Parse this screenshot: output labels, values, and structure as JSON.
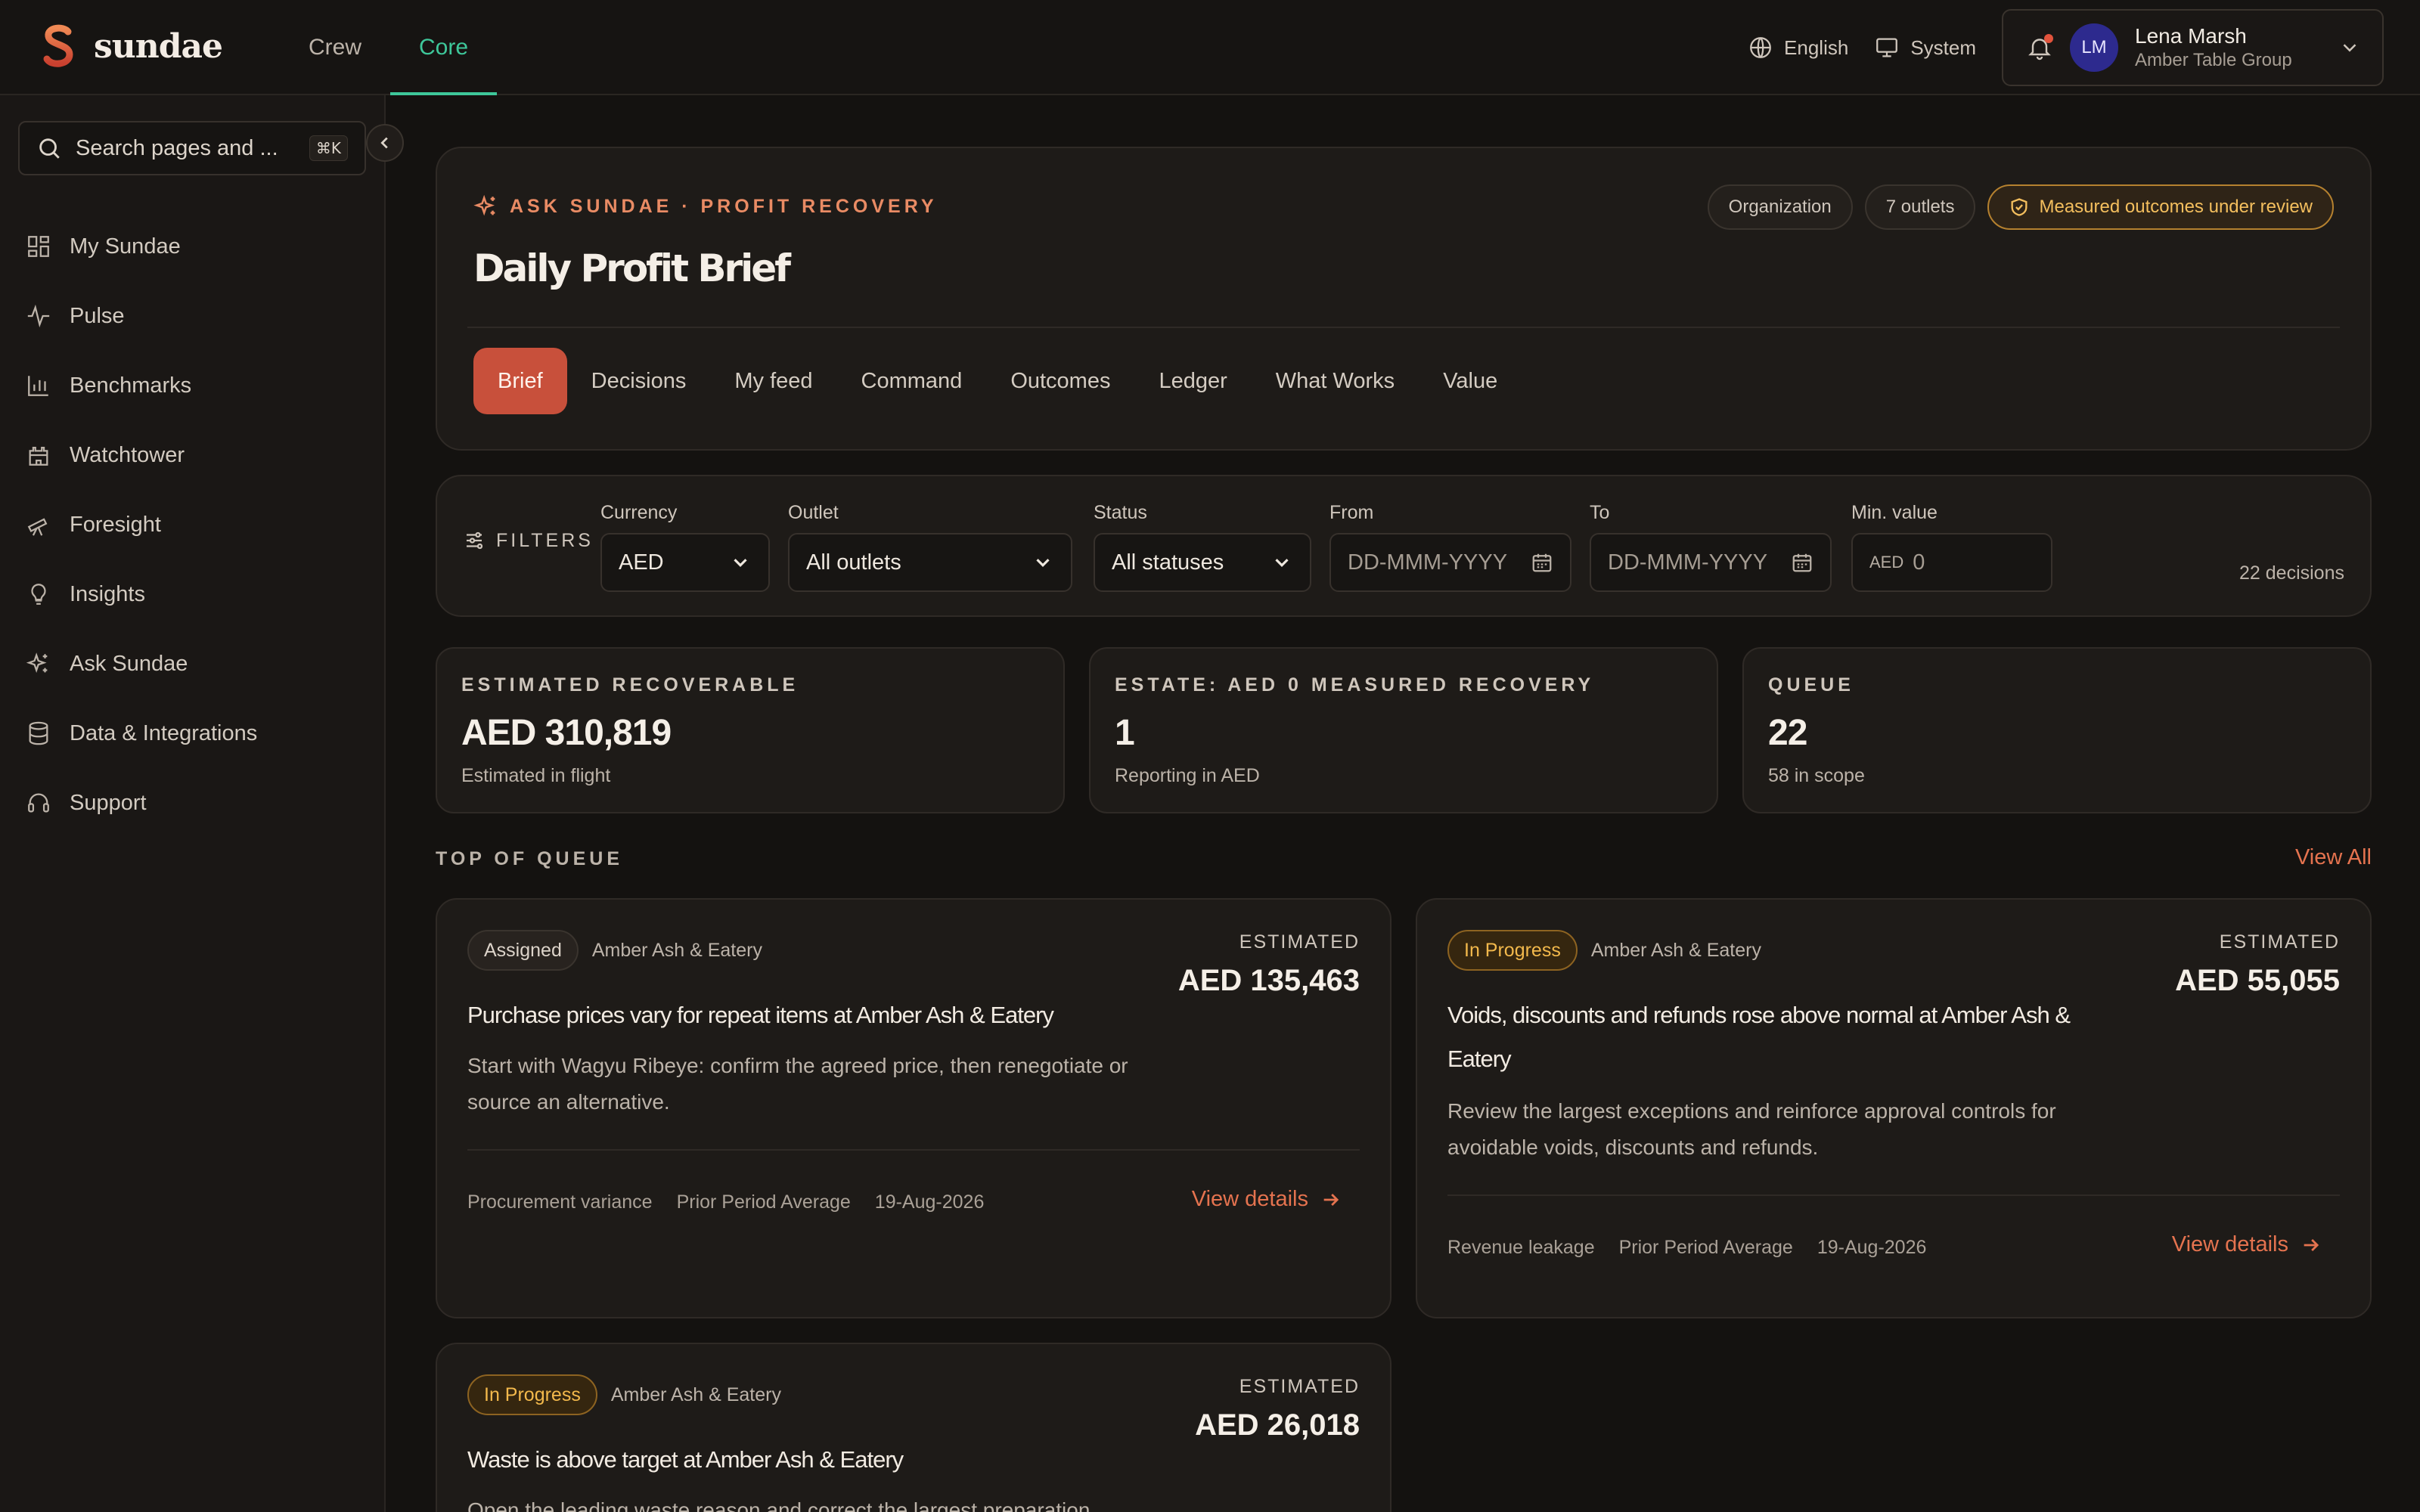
{
  "brand": {
    "name": "sundae",
    "accent": "#e5734f"
  },
  "topnav": [
    {
      "label": "Crew",
      "active": false
    },
    {
      "label": "Core",
      "active": true
    }
  ],
  "topbar": {
    "language": "English",
    "theme": "System",
    "user": {
      "initials": "LM",
      "name": "Lena Marsh",
      "org": "Amber Table Group"
    }
  },
  "sidebar": {
    "search_placeholder": "Search pages and ...",
    "shortcut": "⌘K",
    "items": [
      {
        "label": "My Sundae",
        "icon": "dashboard-icon"
      },
      {
        "label": "Pulse",
        "icon": "pulse-icon"
      },
      {
        "label": "Benchmarks",
        "icon": "bar-chart-icon"
      },
      {
        "label": "Watchtower",
        "icon": "castle-icon"
      },
      {
        "label": "Foresight",
        "icon": "telescope-icon"
      },
      {
        "label": "Insights",
        "icon": "lightbulb-icon"
      },
      {
        "label": "Ask Sundae",
        "icon": "sparkles-icon"
      },
      {
        "label": "Data & Integrations",
        "icon": "database-icon"
      },
      {
        "label": "Support",
        "icon": "headset-icon"
      }
    ]
  },
  "hero": {
    "eyebrow": "ASK SUNDAE · PROFIT RECOVERY",
    "title": "Daily Profit Brief",
    "pills": [
      "Organization",
      "7 outlets"
    ],
    "warning_pill": "Measured outcomes under review",
    "tabs": [
      {
        "label": "Brief",
        "active": true
      },
      {
        "label": "Decisions"
      },
      {
        "label": "My feed"
      },
      {
        "label": "Command"
      },
      {
        "label": "Outcomes"
      },
      {
        "label": "Ledger"
      },
      {
        "label": "What Works"
      },
      {
        "label": "Value"
      }
    ]
  },
  "filters": {
    "label": "FILTERS",
    "currency": {
      "label": "Currency",
      "value": "AED"
    },
    "outlet": {
      "label": "Outlet",
      "value": "All outlets"
    },
    "status": {
      "label": "Status",
      "value": "All statuses"
    },
    "from": {
      "label": "From",
      "placeholder": "DD-MMM-YYYY"
    },
    "to": {
      "label": "To",
      "placeholder": "DD-MMM-YYYY"
    },
    "min_value": {
      "label": "Min. value",
      "prefix": "AED",
      "placeholder": "0"
    },
    "count": "22 decisions"
  },
  "stats": [
    {
      "label": "ESTIMATED RECOVERABLE",
      "value": "AED 310,819",
      "sub": "Estimated in flight"
    },
    {
      "label": "ESTATE: AED 0 MEASURED RECOVERY",
      "value": "1",
      "sub": "Reporting in AED"
    },
    {
      "label": "QUEUE",
      "value": "22",
      "sub": "58 in scope"
    }
  ],
  "queue": {
    "title": "TOP OF QUEUE",
    "view_all": "View All",
    "cards": [
      {
        "status": "Assigned",
        "outlet": "Amber Ash & Eatery",
        "estimated_label": "ESTIMATED",
        "estimated_value": "AED 135,463",
        "title": "Purchase prices vary for repeat items at Amber Ash & Eatery",
        "description": "Start with Wagyu Ribeye: confirm the agreed price, then renegotiate or source an alternative.",
        "category": "Procurement variance",
        "baseline": "Prior Period Average",
        "date": "19-Aug-2026",
        "link": "View details"
      },
      {
        "status": "In Progress",
        "outlet": "Amber Ash & Eatery",
        "estimated_label": "ESTIMATED",
        "estimated_value": "AED 55,055",
        "title": "Voids, discounts and refunds rose above normal at Amber Ash & Eatery",
        "description": "Review the largest exceptions and reinforce approval controls for avoidable voids, discounts and refunds.",
        "category": "Revenue leakage",
        "baseline": "Prior Period Average",
        "date": "19-Aug-2026",
        "link": "View details"
      },
      {
        "status": "In Progress",
        "outlet": "Amber Ash & Eatery",
        "estimated_label": "ESTIMATED",
        "estimated_value": "AED 26,018",
        "title": "Waste is above target at Amber Ash & Eatery",
        "description": "Open the leading waste reason and correct the largest preparation"
      }
    ]
  }
}
